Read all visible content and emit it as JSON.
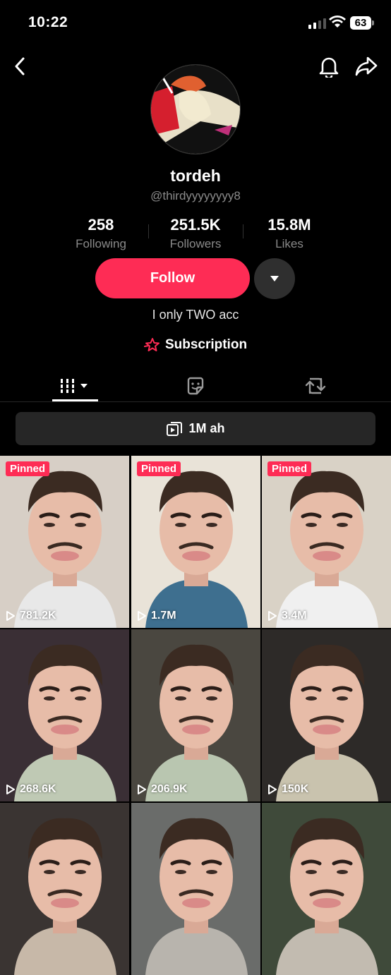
{
  "status_bar": {
    "time": "10:22",
    "battery": "63"
  },
  "profile": {
    "username": "tordeh",
    "handle": "@thirdyyyyyyyy8",
    "bio": "I only TWO acc",
    "subscription_label": "Subscription"
  },
  "stats": [
    {
      "value": "258",
      "label": "Following"
    },
    {
      "value": "251.5K",
      "label": "Followers"
    },
    {
      "value": "15.8M",
      "label": "Likes"
    }
  ],
  "actions": {
    "follow_label": "Follow"
  },
  "playlist": {
    "label": "1M ah"
  },
  "videos": [
    {
      "pinned": "Pinned",
      "views": "781.2K",
      "bg": "#d7cfc6",
      "shirt": "#e8e8e8"
    },
    {
      "pinned": "Pinned",
      "views": "1.7M",
      "bg": "#e9e3d8",
      "shirt": "#3e6f8f"
    },
    {
      "pinned": "Pinned",
      "views": "3.4M",
      "bg": "#d9d2c6",
      "shirt": "#f0f0f0"
    },
    {
      "pinned": "",
      "views": "268.6K",
      "bg": "#3a2f35",
      "shirt": "#bfc9b4"
    },
    {
      "pinned": "",
      "views": "206.9K",
      "bg": "#4a4740",
      "shirt": "#b9c6b0"
    },
    {
      "pinned": "",
      "views": "150K",
      "bg": "#2d2a28",
      "shirt": "#c9c3ae"
    },
    {
      "pinned": "",
      "views": "",
      "bg": "#3a3432",
      "shirt": "#c7b8a8"
    },
    {
      "pinned": "",
      "views": "",
      "bg": "#6a6c6a",
      "shirt": "#b8b4ad"
    },
    {
      "pinned": "",
      "views": "",
      "bg": "#3f4a3a",
      "shirt": "#c2bbb0"
    }
  ],
  "colors": {
    "accent": "#fe2c55",
    "muted": "#8a8a8a"
  }
}
